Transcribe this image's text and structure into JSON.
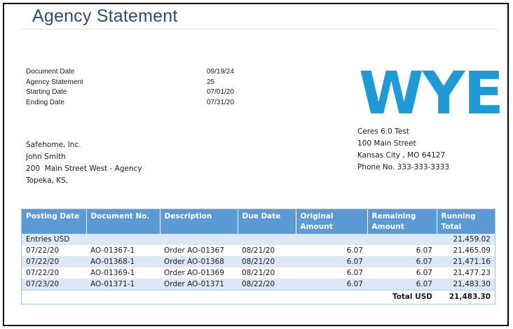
{
  "title": "Agency Statement",
  "brand_color": "#1e9ad6",
  "header_color": "#5b9bd5",
  "meta": [
    {
      "label": "Document Date",
      "value": "09/19/24"
    },
    {
      "label": "Agency Statement",
      "value": "25"
    },
    {
      "label": "Starting Date",
      "value": "07/01/20"
    },
    {
      "label": "Ending Date",
      "value": "07/31/20"
    }
  ],
  "logo_text": "WYE",
  "company": {
    "name": "Ceres 6.0 Test",
    "address": "100 Main Street",
    "city": "Kansas City , MO 64127",
    "phone": "Phone No. 333-333-3333"
  },
  "customer": {
    "name": "Safehome, Inc.",
    "contact": "John Smith",
    "address": "200  Main Street West - Agency",
    "city": "Topeka, KS,"
  },
  "table": {
    "headers": [
      "Posting Date",
      "Document No.",
      "Description",
      "Due Date",
      "Original Amount",
      "Remaining Amount",
      "Running Total"
    ],
    "entries_label": "Entries USD",
    "entries_balance": "21,459.02",
    "rows": [
      [
        "07/22/20",
        "AO-01367-1",
        "Order AO-01367",
        "08/21/20",
        "6.07",
        "6.07",
        "21,465.09"
      ],
      [
        "07/22/20",
        "AO-01368-1",
        "Order AO-01368",
        "08/21/20",
        "6.07",
        "6.07",
        "21,471.16"
      ],
      [
        "07/22/20",
        "AO-01369-1",
        "Order AO-01369",
        "08/21/20",
        "6.07",
        "6.07",
        "21,477.23"
      ],
      [
        "07/23/20",
        "AO-01371-1",
        "Order AO-01371",
        "08/22/20",
        "6.07",
        "6.07",
        "21,483.30"
      ]
    ],
    "total_label": "Total USD",
    "total_value": "21,483.30"
  }
}
